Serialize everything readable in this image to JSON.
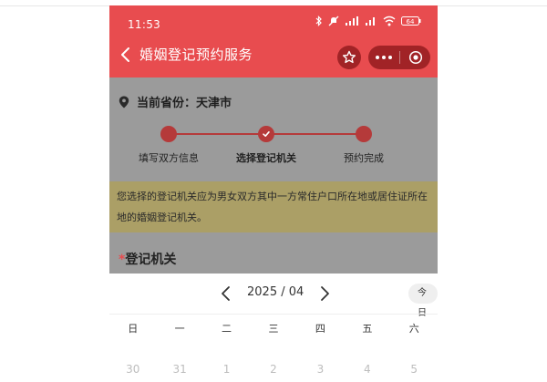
{
  "status_bar": {
    "time": "11:53",
    "battery": "64"
  },
  "nav": {
    "title": "婚姻登记预约服务"
  },
  "province": {
    "label": "当前省份：天津市"
  },
  "steps": [
    {
      "label": "填写双方信息",
      "state": "done"
    },
    {
      "label": "选择登记机关",
      "state": "current"
    },
    {
      "label": "预约完成",
      "state": "pending"
    }
  ],
  "notice": {
    "text": "您选择的登记机关应为男女双方其中一方常住户口所在地或居住证所在地的婚姻登记机关。"
  },
  "section": {
    "required_mark": "*",
    "label": "登记机关"
  },
  "calendar": {
    "month_label": "2025 / 04",
    "today_label": "今日",
    "weekdays": [
      "日",
      "一",
      "二",
      "三",
      "四",
      "五",
      "六"
    ],
    "first_row": [
      "30",
      "31",
      "1",
      "2",
      "3",
      "4",
      "5"
    ]
  },
  "colors": {
    "header_red": "#e84c4f",
    "capsule_dark_red": "#a12326",
    "overlay_gray": "#9b9b9b",
    "notice_bg": "#ab9f66",
    "step_red": "#b53a3a"
  }
}
